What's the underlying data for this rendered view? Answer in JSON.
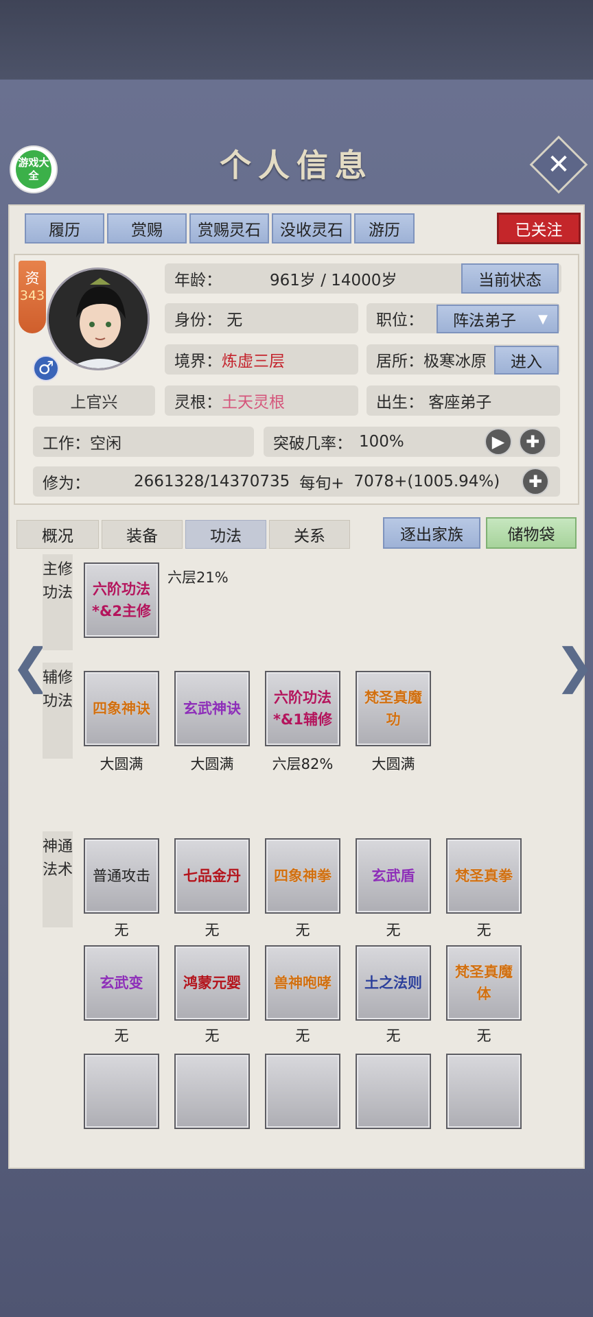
{
  "title": "个人信息",
  "logo_text": "游戏大全",
  "actions": {
    "resume": "履历",
    "reward": "赏赐",
    "reward_stone": "赏赐灵石",
    "confiscate_stone": "没收灵石",
    "travel": "游历",
    "followed": "已关注"
  },
  "profile": {
    "zi_label": "资",
    "zi_value": "343",
    "gender_symbol": "♂",
    "name": "上官兴",
    "age_label": "年龄：",
    "age_value": "961岁 / 14000岁",
    "current_state": "当前状态",
    "identity": "身份：  无",
    "position_label": "职位：",
    "position_value": "阵法弟子",
    "realm_label": "境界：",
    "realm_value": "炼虚三层",
    "residence": "居所：极寒冰原",
    "enter": "进入",
    "root_label": "灵根：",
    "root_value": "土天灵根",
    "birth": "出生：  客座弟子",
    "work": "工作：空闲",
    "breakthrough_label": "突破几率：",
    "breakthrough_value": "100%",
    "cultivation_label": "修为：",
    "cultivation_value": "2661328/14370735",
    "per_turn_label": "每旬+",
    "per_turn_value": "7078+(1005.94%)"
  },
  "tabs": [
    "概况",
    "装备",
    "功法",
    "关系"
  ],
  "expel": "逐出家族",
  "storage": "储物袋",
  "sections": {
    "main": "主修功法",
    "aux": "辅修功法",
    "skills": "神通法术"
  },
  "main_skill": {
    "name": "六阶功法*&2主修",
    "progress": "六层21%"
  },
  "aux_skills": [
    {
      "name": "四象神诀",
      "status": "大圆满"
    },
    {
      "name": "玄武神诀",
      "status": "大圆满"
    },
    {
      "name": "六阶功法*&1辅修",
      "status": "六层82%"
    },
    {
      "name": "梵圣真魔功",
      "status": "大圆满"
    }
  ],
  "spells": [
    {
      "name": "普通攻击",
      "status": "无"
    },
    {
      "name": "七品金丹",
      "status": "无"
    },
    {
      "name": "四象神拳",
      "status": "无"
    },
    {
      "name": "玄武盾",
      "status": "无"
    },
    {
      "name": "梵圣真拳",
      "status": "无"
    },
    {
      "name": "玄武变",
      "status": "无"
    },
    {
      "name": "鸿蒙元婴",
      "status": "无"
    },
    {
      "name": "兽神咆哮",
      "status": "无"
    },
    {
      "name": "土之法则",
      "status": "无"
    },
    {
      "name": "梵圣真魔体",
      "status": "无"
    }
  ],
  "colors": {
    "accent": "#c4262a",
    "tab_blue": "#a9bbdc",
    "panel": "#ebe8e1"
  }
}
